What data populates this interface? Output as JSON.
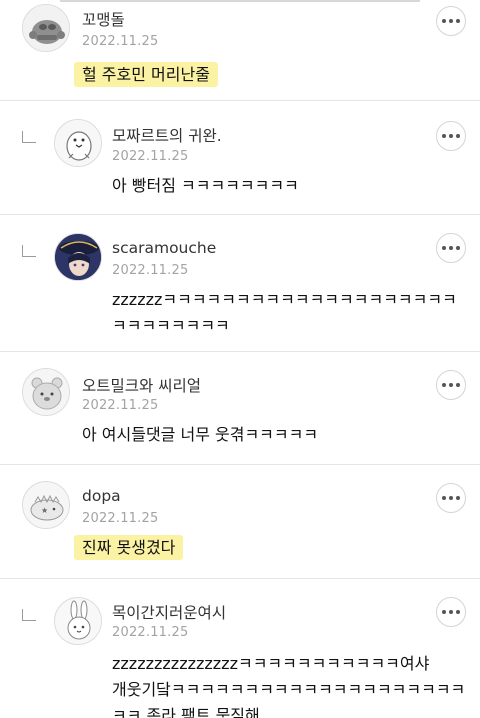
{
  "comments": [
    {
      "nickname": "꼬맹돌",
      "date": "2022.11.25",
      "lines": [
        "헐 주호민 머리난줄"
      ],
      "avatar_icon": "rock-golem-avatar-icon",
      "highlighted": true,
      "is_reply": false
    },
    {
      "nickname": "모짜르트의 귀완.",
      "date": "2022.11.25",
      "lines": [
        "아 빵터짐 ㅋㅋㅋㅋㅋㅋㅋㅋ"
      ],
      "avatar_icon": "penguin-avatar-icon",
      "highlighted": false,
      "is_reply": true
    },
    {
      "nickname": "scaramouche",
      "date": "2022.11.25",
      "lines": [
        "zzzzzzㅋㅋㅋㅋㅋㅋㅋㅋㅋㅋㅋㅋㅋㅋㅋㅋㅋㅋㅋㅋ",
        "ㅋㅋㅋㅋㅋㅋㅋㅋ"
      ],
      "avatar_icon": "anime-character-avatar-icon",
      "highlighted": false,
      "is_reply": true
    },
    {
      "nickname": "오트밀크와 씨리얼",
      "date": "2022.11.25",
      "lines": [
        "아 여시들댓글 너무 웃겪ㅋㅋㅋㅋㅋ"
      ],
      "avatar_icon": "bear-avatar-icon",
      "highlighted": false,
      "is_reply": false
    },
    {
      "nickname": "dopa",
      "date": "2022.11.25",
      "lines": [
        "진짜 못생겼다"
      ],
      "avatar_icon": "dinosaur-avatar-icon",
      "highlighted": true,
      "is_reply": false
    },
    {
      "nickname": "목이간지러운여시",
      "date": "2022.11.25",
      "lines": [
        "zzzzzzzzzzzzzzzㅋㅋㅋㅋㅋㅋㅋㅋㅋㅋㅋ여샤",
        "개웃기닼ㅋㅋㅋㅋㅋㅋㅋㅋㅋㅋㅋㅋㅋㅋㅋㅋㅋㅋㅋㅋ",
        "ㅋㅋ 존라 팩트 뭇짖해"
      ],
      "avatar_icon": "rabbit-avatar-icon",
      "highlighted": false,
      "is_reply": true
    }
  ],
  "colors": {
    "highlight": "#fbf3a3",
    "date": "#a3a3a3",
    "divider": "#e6e6e6"
  }
}
